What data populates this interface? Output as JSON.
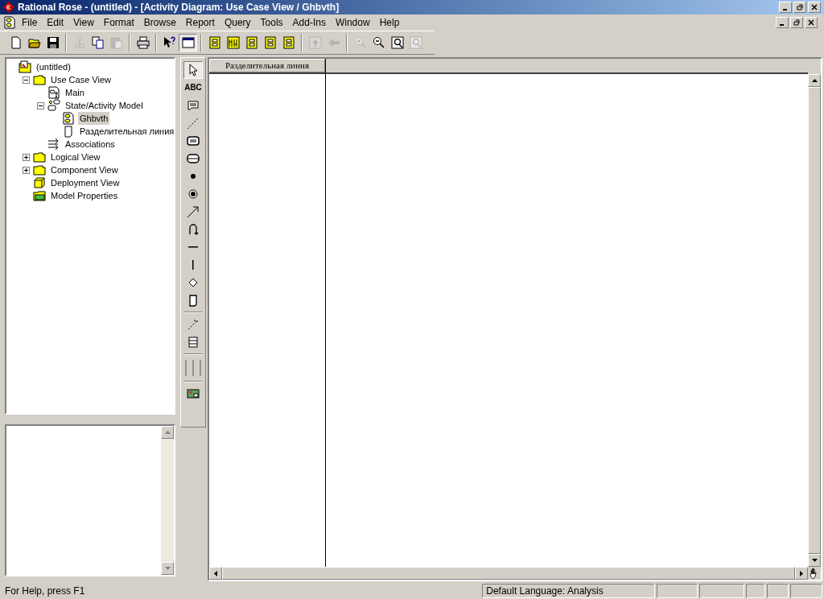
{
  "window": {
    "title": "Rational Rose - (untitled) - [Activity Diagram: Use Case View / Ghbvth]"
  },
  "menu": [
    "File",
    "Edit",
    "View",
    "Format",
    "Browse",
    "Report",
    "Query",
    "Tools",
    "Add-Ins",
    "Window",
    "Help"
  ],
  "toolbar": [
    {
      "kind": "new",
      "disabled": false,
      "selected": false
    },
    {
      "kind": "open",
      "disabled": false,
      "selected": false
    },
    {
      "kind": "save",
      "disabled": false,
      "selected": false
    },
    {
      "kind": "sep"
    },
    {
      "kind": "cut",
      "disabled": true,
      "selected": false
    },
    {
      "kind": "copy",
      "disabled": false,
      "selected": false
    },
    {
      "kind": "paste",
      "disabled": true,
      "selected": false
    },
    {
      "kind": "sep"
    },
    {
      "kind": "print",
      "disabled": false,
      "selected": false
    },
    {
      "kind": "sep"
    },
    {
      "kind": "help",
      "disabled": false,
      "selected": false
    },
    {
      "kind": "window",
      "disabled": false,
      "selected": true
    },
    {
      "kind": "sep"
    },
    {
      "kind": "diagram",
      "disabled": false,
      "selected": false
    },
    {
      "kind": "wave",
      "disabled": false,
      "selected": false
    },
    {
      "kind": "diagram",
      "disabled": false,
      "selected": false
    },
    {
      "kind": "diagram",
      "disabled": false,
      "selected": false
    },
    {
      "kind": "diagram",
      "disabled": false,
      "selected": false
    },
    {
      "kind": "sep"
    },
    {
      "kind": "up",
      "disabled": true,
      "selected": false
    },
    {
      "kind": "back",
      "disabled": true,
      "selected": false
    },
    {
      "kind": "sep"
    },
    {
      "kind": "zoomin",
      "disabled": true,
      "selected": false
    },
    {
      "kind": "zoomout",
      "disabled": false,
      "selected": false
    },
    {
      "kind": "fit",
      "disabled": false,
      "selected": false
    },
    {
      "kind": "fit",
      "disabled": true,
      "selected": false
    }
  ],
  "tree": [
    {
      "label": "(untitled)",
      "kind": "model",
      "selected": false,
      "children": [
        {
          "label": "Use Case View",
          "kind": "folder",
          "expanded": true,
          "selected": false,
          "children": [
            {
              "label": "Main",
              "kind": "usecase-diagram",
              "selected": false
            },
            {
              "label": "State/Activity Model",
              "kind": "state-model",
              "expanded": true,
              "selected": false,
              "children": [
                {
                  "label": "Ghbvth",
                  "kind": "activity-diagram",
                  "selected": true
                },
                {
                  "label": "Разделительная линия",
                  "kind": "swimlane",
                  "selected": false
                }
              ]
            },
            {
              "label": "Associations",
              "kind": "associations",
              "selected": false
            }
          ]
        },
        {
          "label": "Logical View",
          "kind": "folder",
          "expanded": false,
          "selected": false
        },
        {
          "label": "Component View",
          "kind": "folder",
          "expanded": false,
          "selected": false
        },
        {
          "label": "Deployment View",
          "kind": "deployment",
          "selected": false
        },
        {
          "label": "Model Properties",
          "kind": "properties",
          "selected": false
        }
      ]
    }
  ],
  "palette": [
    {
      "kind": "pointer",
      "selected": true
    },
    {
      "kind": "text",
      "label": "ABC",
      "selected": false
    },
    {
      "kind": "note",
      "selected": false
    },
    {
      "kind": "anchor",
      "selected": false
    },
    {
      "kind": "state",
      "selected": false
    },
    {
      "kind": "activity",
      "selected": false
    },
    {
      "kind": "start",
      "selected": false
    },
    {
      "kind": "end",
      "selected": false
    },
    {
      "kind": "transition",
      "selected": false
    },
    {
      "kind": "self",
      "selected": false
    },
    {
      "kind": "hbar",
      "selected": false
    },
    {
      "kind": "vbar",
      "selected": false
    },
    {
      "kind": "decision",
      "selected": false
    },
    {
      "kind": "object",
      "selected": false
    },
    {
      "kind": "sep"
    },
    {
      "kind": "flow",
      "selected": false
    },
    {
      "kind": "stack",
      "selected": false
    },
    {
      "kind": "sep"
    },
    {
      "kind": "swimlane",
      "selected": false
    },
    {
      "kind": "sep"
    },
    {
      "kind": "image",
      "selected": false
    }
  ],
  "diagram": {
    "swimlanes": [
      "Разделительная линия"
    ]
  },
  "status_bar": {
    "help": "For Help, press F1",
    "language": "Default Language: Analysis"
  }
}
